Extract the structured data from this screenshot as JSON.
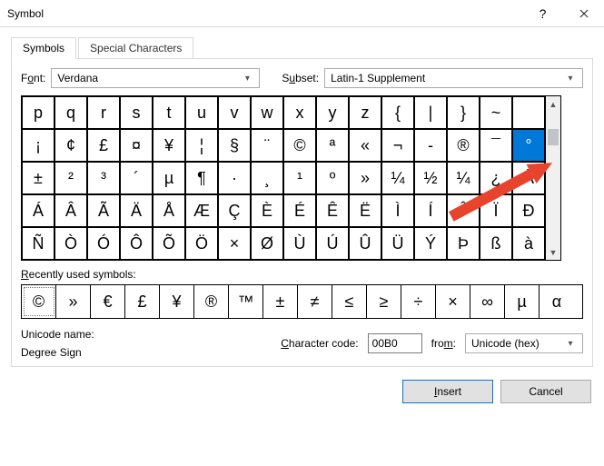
{
  "window": {
    "title": "Symbol"
  },
  "tabs": {
    "active": "Symbols",
    "inactive": "Special Characters"
  },
  "font": {
    "label_pre": "F",
    "label_ul": "o",
    "label_post": "nt:",
    "value": "Verdana"
  },
  "subset": {
    "label_pre": "S",
    "label_ul": "u",
    "label_post": "bset:",
    "value": "Latin-1 Supplement"
  },
  "grid": [
    [
      "p",
      "q",
      "r",
      "s",
      "t",
      "u",
      "v",
      "w",
      "x",
      "y",
      "z",
      "{",
      "|",
      "}",
      "~",
      ""
    ],
    [
      "¡",
      "¢",
      "£",
      "¤",
      "¥",
      "¦",
      "§",
      "¨",
      "©",
      "ª",
      "«",
      "¬",
      "-",
      "®",
      "¯",
      "°"
    ],
    [
      "±",
      "²",
      "³",
      "´",
      "µ",
      "¶",
      "·",
      "¸",
      "¹",
      "º",
      "»",
      "¼",
      "½",
      "¼",
      "¿",
      "À"
    ],
    [
      "Á",
      "Â",
      "Ã",
      "Ä",
      "Å",
      "Æ",
      "Ç",
      "È",
      "É",
      "Ê",
      "Ë",
      "Ì",
      "Í",
      "Î",
      "Ï",
      "Đ"
    ],
    [
      "Ñ",
      "Ò",
      "Ó",
      "Ô",
      "Õ",
      "Ö",
      "×",
      "Ø",
      "Ù",
      "Ú",
      "Û",
      "Ü",
      "Ý",
      "Þ",
      "ß",
      "à"
    ]
  ],
  "selected": {
    "row": 1,
    "col": 15
  },
  "recent_label_pre": "",
  "recent_label_ul": "R",
  "recent_label_post": "ecently used symbols:",
  "recent": [
    "©",
    "»",
    "€",
    "£",
    "¥",
    "®",
    "™",
    "±",
    "≠",
    "≤",
    "≥",
    "÷",
    "×",
    "∞",
    "µ",
    "α"
  ],
  "unicode": {
    "label": "Unicode name:",
    "name": "Degree Sign"
  },
  "charcode": {
    "label_pre": "",
    "label_ul": "C",
    "label_post": "haracter code:",
    "value": "00B0"
  },
  "from": {
    "label_pre": "fro",
    "label_ul": "m",
    "label_post": ":",
    "value": "Unicode (hex)"
  },
  "buttons": {
    "insert_ul": "I",
    "insert_post": "nsert",
    "cancel": "Cancel"
  }
}
